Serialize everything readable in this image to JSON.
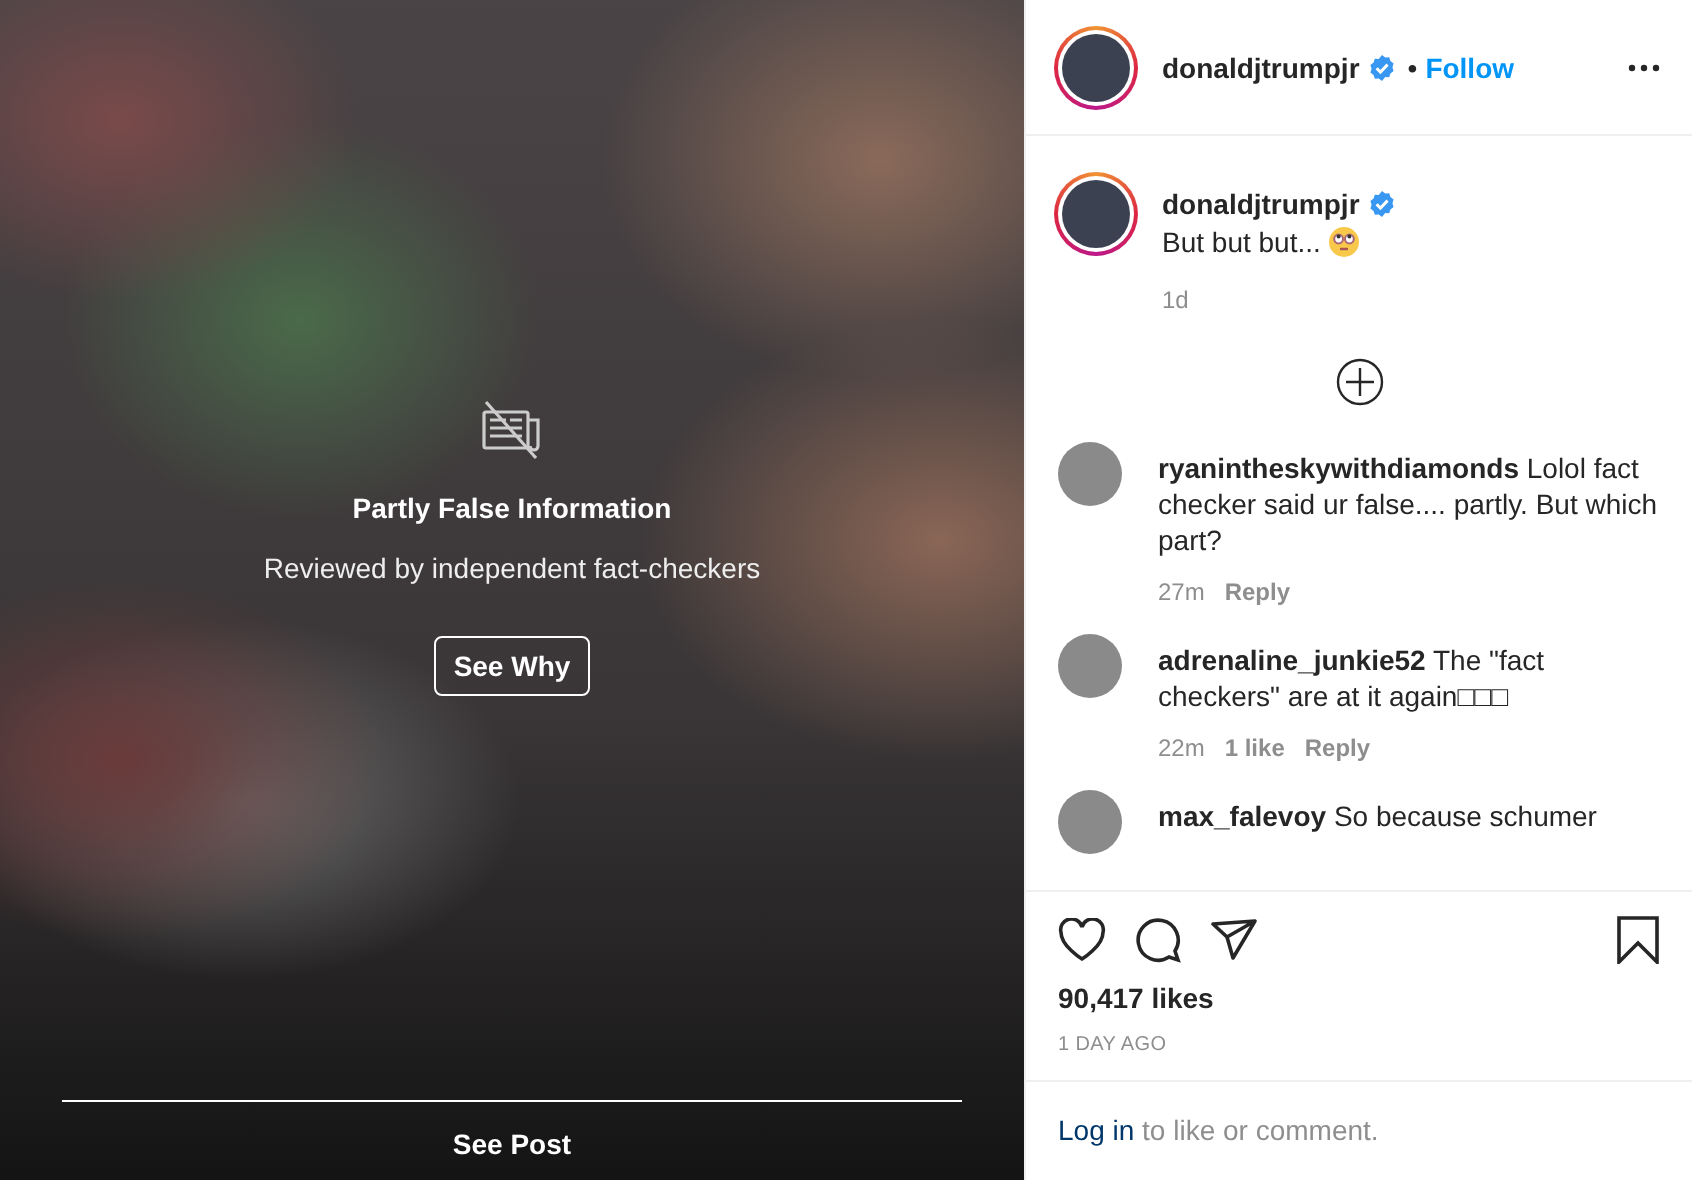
{
  "post": {
    "overlay": {
      "title": "Partly False Information",
      "subtitle": "Reviewed by independent fact-checkers",
      "button": "See Why",
      "footer": "See Post"
    }
  },
  "header": {
    "username": "donaldjtrumpjr",
    "verified": true,
    "separator": "•",
    "follow": "Follow"
  },
  "caption": {
    "username": "donaldjtrumpjr",
    "verified": true,
    "text": "But but but...",
    "time": "1d"
  },
  "comments": [
    {
      "username": "ryanintheskywithdiamonds",
      "text": "Lolol fact checker said ur false.... partly. But which part?",
      "time": "27m",
      "reply": "Reply"
    },
    {
      "username": "adrenaline_junkie52",
      "text": "The \"fact checkers\" are at it again□□□",
      "time": "22m",
      "likes": "1 like",
      "reply": "Reply"
    },
    {
      "username": "max_falevoy",
      "text": "So because schumer"
    }
  ],
  "actions": {
    "likes": "90,417 likes",
    "date": "1 DAY AGO"
  },
  "login": {
    "link": "Log in",
    "text": "to like or comment."
  }
}
